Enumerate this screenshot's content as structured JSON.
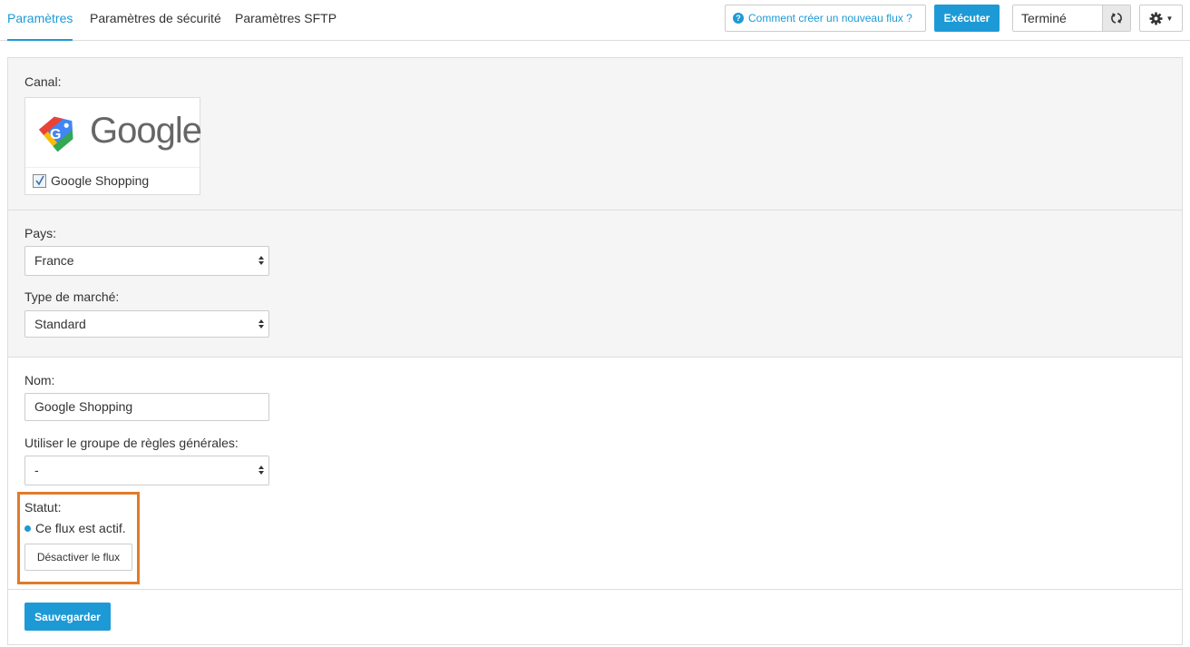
{
  "tabs": [
    {
      "label": "Paramètres",
      "active": true
    },
    {
      "label": "Paramètres de sécurité",
      "active": false
    },
    {
      "label": "Paramètres SFTP",
      "active": false
    }
  ],
  "toolbar": {
    "help_label": "Comment créer un nouveau flux ?",
    "run_label": "Exécuter",
    "status_value": "Terminé"
  },
  "channel": {
    "label": "Canal:",
    "logo_text": "Google",
    "option_label": "Google Shopping",
    "checked": true
  },
  "country": {
    "label": "Pays:",
    "value": "France"
  },
  "market_type": {
    "label": "Type de marché:",
    "value": "Standard"
  },
  "name": {
    "label": "Nom:",
    "value": "Google Shopping"
  },
  "rules_group": {
    "label": "Utiliser le groupe de règles générales:",
    "value": "-"
  },
  "status": {
    "label": "Statut:",
    "text": "Ce flux est actif.",
    "deactivate_label": "Désactiver le flux"
  },
  "save_label": "Sauvegarder",
  "colors": {
    "accent": "#1d9ad6",
    "highlight": "#e07b2a",
    "section_bg": "#f5f5f5"
  }
}
